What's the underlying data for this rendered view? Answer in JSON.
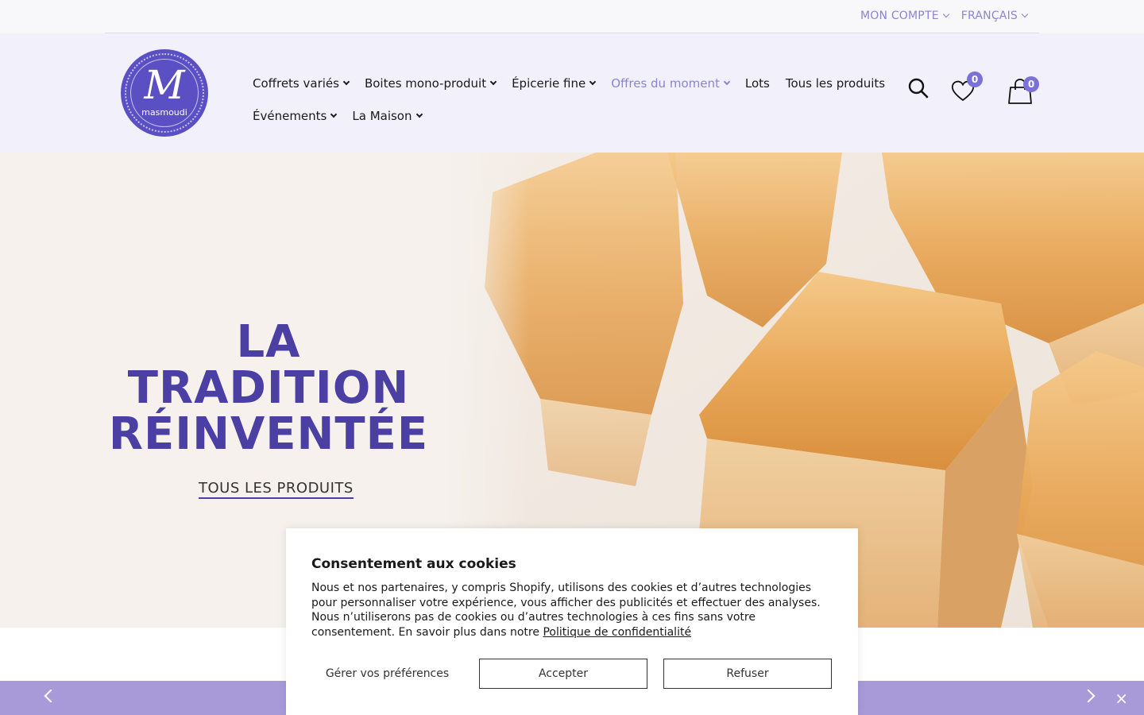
{
  "topbar": {
    "account_label": "MON COMPTE",
    "language_label": "FRANÇAIS"
  },
  "brand": {
    "logo_monogram": "M",
    "logo_text": "masmoudi",
    "accent_color": "#5b4fc4"
  },
  "nav": {
    "row1": [
      {
        "label": "Coffrets variés",
        "dropdown": true,
        "active": false
      },
      {
        "label": "Boites mono-produit",
        "dropdown": true,
        "active": false
      },
      {
        "label": "Épicerie fine",
        "dropdown": true,
        "active": false
      },
      {
        "label": "Offres du moment",
        "dropdown": true,
        "active": true
      },
      {
        "label": "Lots",
        "dropdown": false,
        "active": false
      },
      {
        "label": "Tous les produits",
        "dropdown": false,
        "active": false
      }
    ],
    "row2": [
      {
        "label": "Événements",
        "dropdown": true,
        "active": false
      },
      {
        "label": "La Maison",
        "dropdown": true,
        "active": false
      }
    ]
  },
  "header_icons": {
    "search_icon": "search-icon",
    "wishlist_icon": "heart-icon",
    "wishlist_count": "0",
    "cart_icon": "bag-icon",
    "cart_count": "0"
  },
  "hero": {
    "title_line1": "LA",
    "title_line2": "TRADITION",
    "title_line3": "RÉINVENTÉE",
    "cta_label": "TOUS LES PRODUITS",
    "title_color": "#4b3fa3"
  },
  "cookie": {
    "title": "Consentement aux cookies",
    "body": "Nous et nos partenaires, y compris Shopify, utilisons des cookies et d’autres technologies pour personnaliser votre expérience, vous afficher des publicités et effectuer des analyses. Nous n’utiliserons pas de cookies ou d’autres technologies à ces fins sans votre consentement. En savoir plus dans notre",
    "policy_link": "Politique de confidentialité",
    "manage_label": "Gérer vos préférences",
    "accept_label": "Accepter",
    "decline_label": "Refuser"
  },
  "announcement": {
    "bar_color": "#a89ad8",
    "close_glyph": "×"
  }
}
